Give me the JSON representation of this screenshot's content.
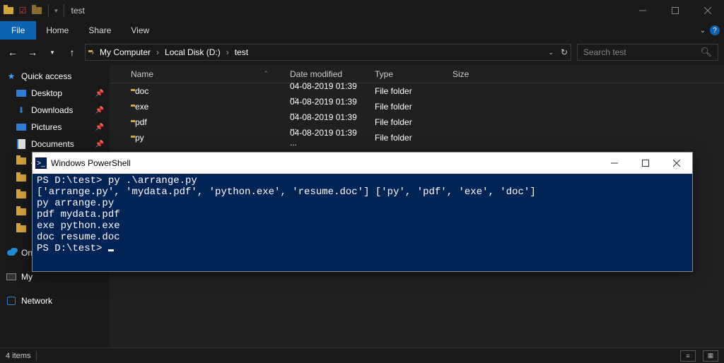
{
  "explorer": {
    "title": "test",
    "menu": {
      "file": "File",
      "home": "Home",
      "share": "Share",
      "view": "View"
    },
    "breadcrumbs": [
      "My Computer",
      "Local Disk (D:)",
      "test"
    ],
    "search_placeholder": "Search test",
    "tree": {
      "quick_access": "Quick access",
      "desktop": "Desktop",
      "downloads": "Downloads",
      "pictures": "Pictures",
      "documents": "Documents",
      "onedrive_prefix": "On",
      "my_prefix": "My",
      "network": "Network"
    },
    "columns": {
      "name": "Name",
      "date": "Date modified",
      "type": "Type",
      "size": "Size"
    },
    "rows": [
      {
        "name": "doc",
        "date": "04-08-2019 01:39 ...",
        "type": "File folder",
        "size": ""
      },
      {
        "name": "exe",
        "date": "04-08-2019 01:39 ...",
        "type": "File folder",
        "size": ""
      },
      {
        "name": "pdf",
        "date": "04-08-2019 01:39 ...",
        "type": "File folder",
        "size": ""
      },
      {
        "name": "py",
        "date": "04-08-2019 01:39 ...",
        "type": "File folder",
        "size": ""
      }
    ],
    "status": "4 items"
  },
  "powershell": {
    "title": "Windows PowerShell",
    "lines": [
      "PS D:\\test> py .\\arrange.py",
      "['arrange.py', 'mydata.pdf', 'python.exe', 'resume.doc'] ['py', 'pdf', 'exe', 'doc']",
      "py arrange.py",
      "pdf mydata.pdf",
      "exe python.exe",
      "doc resume.doc",
      "PS D:\\test> "
    ]
  }
}
